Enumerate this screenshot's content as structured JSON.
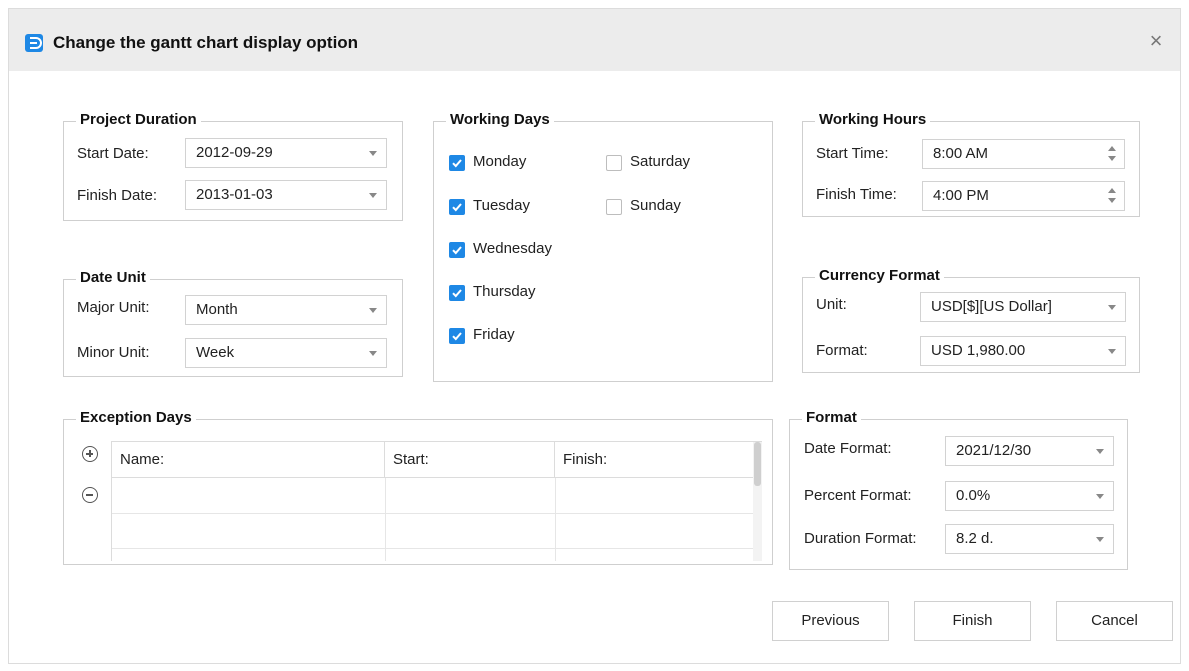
{
  "dialog": {
    "title": "Change the gantt chart display option",
    "icon": "app-logo-icon",
    "close_icon": "close-icon"
  },
  "project_duration": {
    "title": "Project Duration",
    "start_label": "Start Date:",
    "start_value": "2012-09-29",
    "finish_label": "Finish Date:",
    "finish_value": "2013-01-03"
  },
  "working_days": {
    "title": "Working Days",
    "days": [
      {
        "label": "Monday",
        "checked": true
      },
      {
        "label": "Tuesday",
        "checked": true
      },
      {
        "label": "Wednesday",
        "checked": true
      },
      {
        "label": "Thursday",
        "checked": true
      },
      {
        "label": "Friday",
        "checked": true
      },
      {
        "label": "Saturday",
        "checked": false
      },
      {
        "label": "Sunday",
        "checked": false
      }
    ]
  },
  "working_hours": {
    "title": "Working Hours",
    "start_label": "Start Time:",
    "start_value": "8:00 AM",
    "finish_label": "Finish Time:",
    "finish_value": "4:00 PM"
  },
  "date_unit": {
    "title": "Date Unit",
    "major_label": "Major Unit:",
    "major_value": "Month",
    "minor_label": "Minor Unit:",
    "minor_value": "Week"
  },
  "currency_format": {
    "title": "Currency Format",
    "unit_label": "Unit:",
    "unit_value": "USD[$][US Dollar]",
    "format_label": "Format:",
    "format_value": "USD 1,980.00"
  },
  "exception_days": {
    "title": "Exception Days",
    "columns": [
      "Name:",
      "Start:",
      "Finish:"
    ],
    "rows": []
  },
  "format": {
    "title": "Format",
    "date_label": "Date Format:",
    "date_value": "2021/12/30",
    "percent_label": "Percent Format:",
    "percent_value": "0.0%",
    "duration_label": "Duration Format:",
    "duration_value": "8.2 d."
  },
  "buttons": {
    "previous": "Previous",
    "finish": "Finish",
    "cancel": "Cancel"
  },
  "colors": {
    "accent": "#1e88e5",
    "titlebar": "#ececec"
  }
}
